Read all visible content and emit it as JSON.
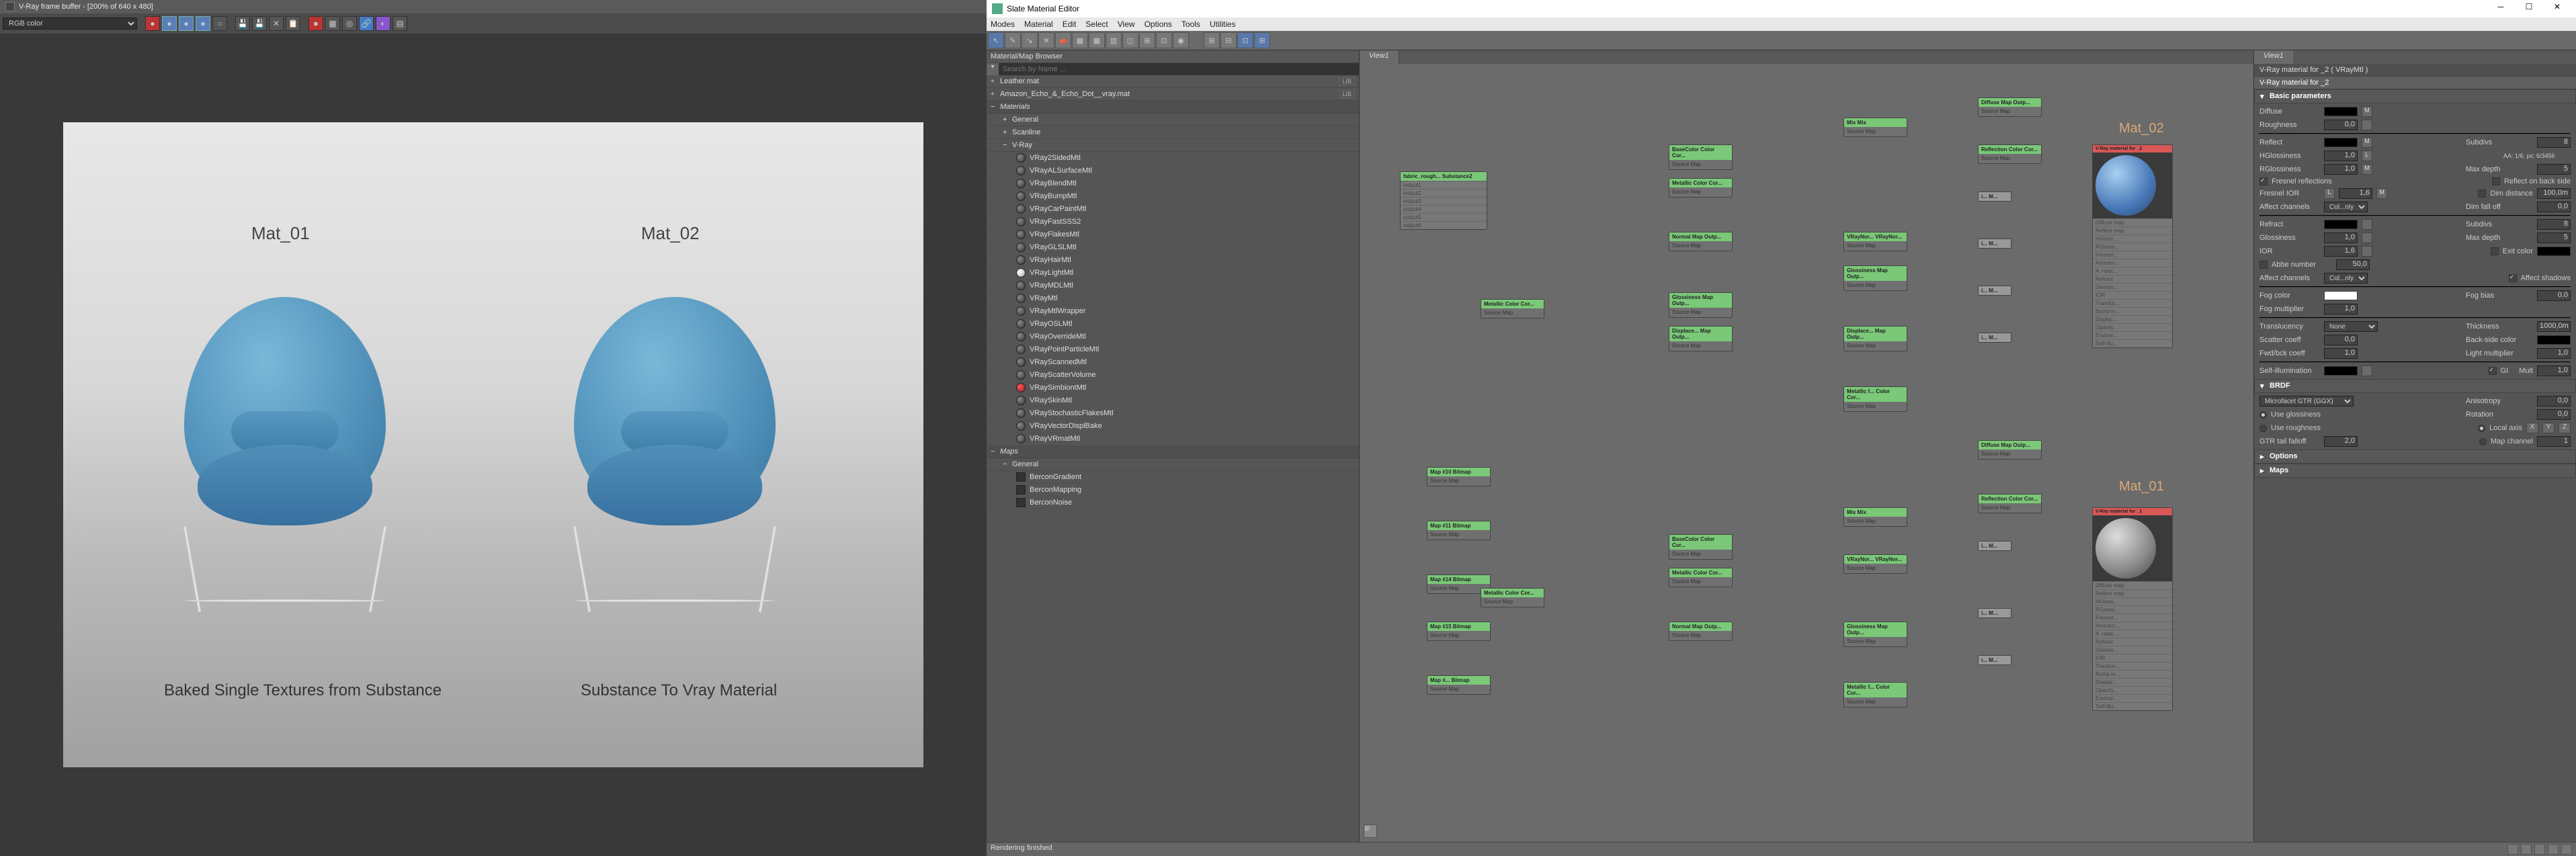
{
  "vfb": {
    "title": "V-Ray frame buffer - [200% of 640 x 480]",
    "channel": "RGB color",
    "render": {
      "mat1_label": "Mat_01",
      "mat2_label": "Mat_02",
      "caption1": "Baked Single Textures from Substance",
      "caption2": "Substance To Vray Material"
    }
  },
  "sme": {
    "title": "Slate Material Editor",
    "menus": [
      "Modes",
      "Material",
      "Edit",
      "Select",
      "View",
      "Options",
      "Tools",
      "Utilities"
    ],
    "browser": {
      "header": "Material/Map Browser",
      "search_placeholder": "Search by Name ...",
      "libs": [
        {
          "name": "Leather.mat",
          "tag": "LIB"
        },
        {
          "name": "Amazon_Echo_&_Echo_Dot__vray.mat",
          "tag": "LIB"
        }
      ],
      "materials_hdr": "Materials",
      "general_hdr": "General",
      "scanline_hdr": "Scanline",
      "vray_hdr": "V-Ray",
      "vray_mats": [
        "VRay2SidedMtl",
        "VRayALSurfaceMtl",
        "VRayBlendMtl",
        "VRayBumpMtl",
        "VRayCarPaintMtl",
        "VRayFastSSS2",
        "VRayFlakesMtl",
        "VRayGLSLMtl",
        "VRayHairMtl",
        "VRayLightMtl",
        "VRayMDLMtl",
        "VRayMtl",
        "VRayMtlWrapper",
        "VRayOSLMtl",
        "VRayOverrideMtl",
        "VRayPointParticleMtl",
        "VRayScannedMtl",
        "VRayScatterVolume",
        "VRaySimbiontMtl",
        "VRaySkinMtl",
        "VRayStochasticFlakesMtl",
        "VRayVectorDisplBake",
        "VRayVRmatMtl"
      ],
      "vray_special": {
        "white": 9,
        "red": 18
      },
      "maps_hdr": "Maps",
      "maps_general_hdr": "General",
      "maps_items": [
        "BerconGradient",
        "BerconMapping",
        "BerconNoise"
      ]
    },
    "graph": {
      "tab": "View1",
      "mat02_label": "Mat_02",
      "mat01_label": "Mat_01",
      "node_labels": {
        "fabric": "fabric_rough...\nSubstance2",
        "basecolor": "BaseColor\nColor Cor...",
        "metallic": "Metallic\nColor Cor...",
        "normal": "Normal\nMap Outp...",
        "glossiness": "Glossiness\nMap Outp...",
        "displace": "Displace...\nMap Outp...",
        "metallic2": "Metallic f...\nColor Cor...",
        "mix": "Mix\nMix",
        "vraynor": "VRayNor...\nVRayNor...",
        "diffuse_out": "Diffuse\nMap Outp...",
        "reflection_out": "Reflection\nColor Cor...",
        "i_out": "i...\nM...",
        "bitmap": "Map #...\nBitmap",
        "bitmap10": "Map #10\nBitmap",
        "bitmap11": "Map #11\nBitmap",
        "bitmap14": "Map #14\nBitmap",
        "bitmap15": "Map #15\nBitmap",
        "joint": "Source Map"
      },
      "slot_labels": [
        "Diffuse map",
        "Reflect map",
        "HGloss...",
        "RGlossi...",
        "Fresnel...",
        "Anisotro...",
        "A. rotat...",
        "Refract",
        "Glossin...",
        "IOR",
        "Transluc...",
        "Bump m...",
        "Displac...",
        "Opacity...",
        "Environ...",
        "Self-illu..."
      ]
    },
    "params": {
      "tab": "View1",
      "title1": "V-Ray material for _2  ( VRayMtl )",
      "title2": "V-Ray material for _2",
      "basic_hdr": "Basic parameters",
      "diffuse_lbl": "Diffuse",
      "roughness_lbl": "Roughness",
      "roughness_val": "0,0",
      "reflect_lbl": "Reflect",
      "subdivs_lbl": "Subdivs",
      "subdivs_val": "8",
      "hgloss_lbl": "HGlossiness",
      "hgloss_val": "1,0",
      "aa_lbl": "AA: 1/6; px: 6/3456",
      "rgloss_lbl": "RGlossiness",
      "rgloss_val": "1,0",
      "maxdepth_lbl": "Max depth",
      "maxdepth_val": "5",
      "fresnel_lbl": "Fresnel reflections",
      "backside_lbl": "Reflect on back side",
      "fresnel_ior_lbl": "Fresnel IOR",
      "fresnel_ior_val": "1,6",
      "dimdist_lbl": "Dim distance",
      "dimdist_val": "100,0m",
      "affect_lbl": "Affect channels",
      "affect_val": "Col...nly",
      "dimfall_lbl": "Dim fall off",
      "dimfall_val": "0,0",
      "refract_lbl": "Refract",
      "refr_subdivs_val": "8",
      "gloss_lbl": "Glossiness",
      "gloss_val": "1,0",
      "ior_lbl": "IOR",
      "ior_val": "1,6",
      "refr_maxdepth_val": "5",
      "abbe_lbl": "Abbe number",
      "abbe_val": "50,0",
      "exitcolor_lbl": "Exit color",
      "affect_shadows_lbl": "Affect shadows",
      "fogcolor_lbl": "Fog color",
      "fogbias_lbl": "Fog bias",
      "fogbias_val": "0,0",
      "fogmult_lbl": "Fog multiplier",
      "fogmult_val": "1,0",
      "translucency_lbl": "Translucency",
      "translucency_val": "None",
      "thickness_lbl": "Thickness",
      "thickness_val": "1000,0m",
      "scatter_lbl": "Scatter coeff",
      "scatter_val": "0,0",
      "backside_color_lbl": "Back-side color",
      "fwdback_lbl": "Fwd/bck coeff",
      "fwdback_val": "1,0",
      "lightmult_lbl": "Light multiplier",
      "lightmult_val": "1,0",
      "selfillum_lbl": "Self-illumination",
      "gi_lbl": "GI",
      "mult_lbl": "Mult",
      "mult_val": "1,0",
      "brdf_hdr": "BRDF",
      "brdf_type": "Microfacet GTR (GGX)",
      "aniso_lbl": "Anisotropy",
      "aniso_val": "0,0",
      "usegloss_lbl": "Use glossiness",
      "rotation_lbl": "Rotation",
      "rotation_val": "0,0",
      "userough_lbl": "Use roughness",
      "localaxis_lbl": "Local axis",
      "gtr_lbl": "GTR tail falloff",
      "gtr_val": "2,0",
      "mapchannel_lbl": "Map channel",
      "mapchannel_val": "1",
      "options_hdr": "Options",
      "maps_hdr2": "Maps"
    },
    "status": "Rendering finished"
  }
}
